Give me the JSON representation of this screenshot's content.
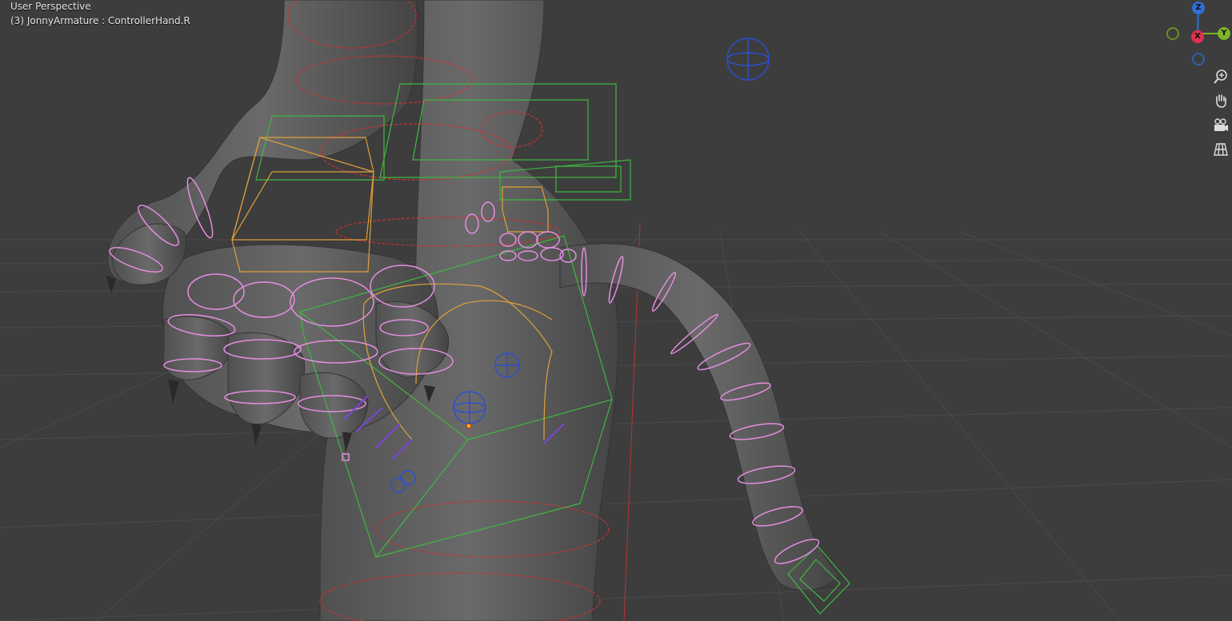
{
  "viewport": {
    "title": "User Perspective",
    "object_info": "(3) JonnyArmature : ControllerHand.R",
    "background": "#3d3d3d"
  },
  "gizmo": {
    "axes": [
      {
        "label": "Z",
        "color": "#2f6fd6"
      },
      {
        "label": "X",
        "color": "#e0334f"
      },
      {
        "label": "Y",
        "color": "#7db42c"
      }
    ]
  },
  "toolbar": {
    "items": [
      {
        "name": "zoom",
        "icon": "zoom-in-icon"
      },
      {
        "name": "pan",
        "icon": "hand-icon"
      },
      {
        "name": "camera",
        "icon": "camera-icon"
      },
      {
        "name": "ortho",
        "icon": "grid-icon"
      }
    ]
  },
  "colors": {
    "mesh": "#5d5d5d",
    "bone_pink": "#e58ee0",
    "bone_green": "#3fb83f",
    "bone_orange": "#e0a03a",
    "bone_red": "#c93232",
    "bone_blue": "#2e4fd0"
  }
}
